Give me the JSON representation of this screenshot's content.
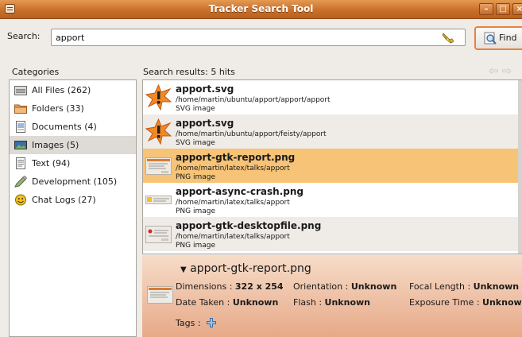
{
  "window": {
    "title": "Tracker Search Tool"
  },
  "search": {
    "label": "Search:",
    "value": "apport",
    "find_label": "Find"
  },
  "categories": {
    "header": "Categories",
    "items": [
      {
        "label": "All Files (262)",
        "icon": "all-files-icon"
      },
      {
        "label": "Folders (33)",
        "icon": "folder-icon"
      },
      {
        "label": "Documents (4)",
        "icon": "document-icon"
      },
      {
        "label": "Images (5)",
        "icon": "image-icon",
        "selected": true
      },
      {
        "label": "Text (94)",
        "icon": "text-icon"
      },
      {
        "label": "Development (105)",
        "icon": "development-icon"
      },
      {
        "label": "Chat Logs (27)",
        "icon": "chat-icon"
      }
    ]
  },
  "results": {
    "header": "Search results: 5 hits",
    "items": [
      {
        "name": "apport.svg",
        "path": "/home/martin/ubuntu/apport/apport/apport",
        "type": "SVG image"
      },
      {
        "name": "apport.svg",
        "path": "/home/martin/ubuntu/apport/feisty/apport",
        "type": "SVG image"
      },
      {
        "name": "apport-gtk-report.png",
        "path": "/home/martin/latex/talks/apport",
        "type": "PNG image",
        "selected": true
      },
      {
        "name": "apport-async-crash.png",
        "path": "/home/martin/latex/talks/apport",
        "type": "PNG image"
      },
      {
        "name": "apport-gtk-desktopfile.png",
        "path": "/home/martin/latex/talks/apport",
        "type": "PNG image"
      }
    ]
  },
  "details": {
    "title": "apport-gtk-report.png",
    "dimensions_label": "Dimensions : ",
    "dimensions": "322 x 254",
    "orientation_label": "Orientation : ",
    "orientation": "Unknown",
    "focal_label": "Focal Length : ",
    "focal": "Unknown",
    "date_label": "Date Taken : ",
    "date": "Unknown",
    "flash_label": "Flash : ",
    "flash": "Unknown",
    "exposure_label": "Exposure Time : ",
    "exposure": "Unknown",
    "tags_label": "Tags :"
  },
  "colors": {
    "selected_row": "#f6c377",
    "accent": "#e8823a",
    "details_bg": "#f0c4a6"
  }
}
